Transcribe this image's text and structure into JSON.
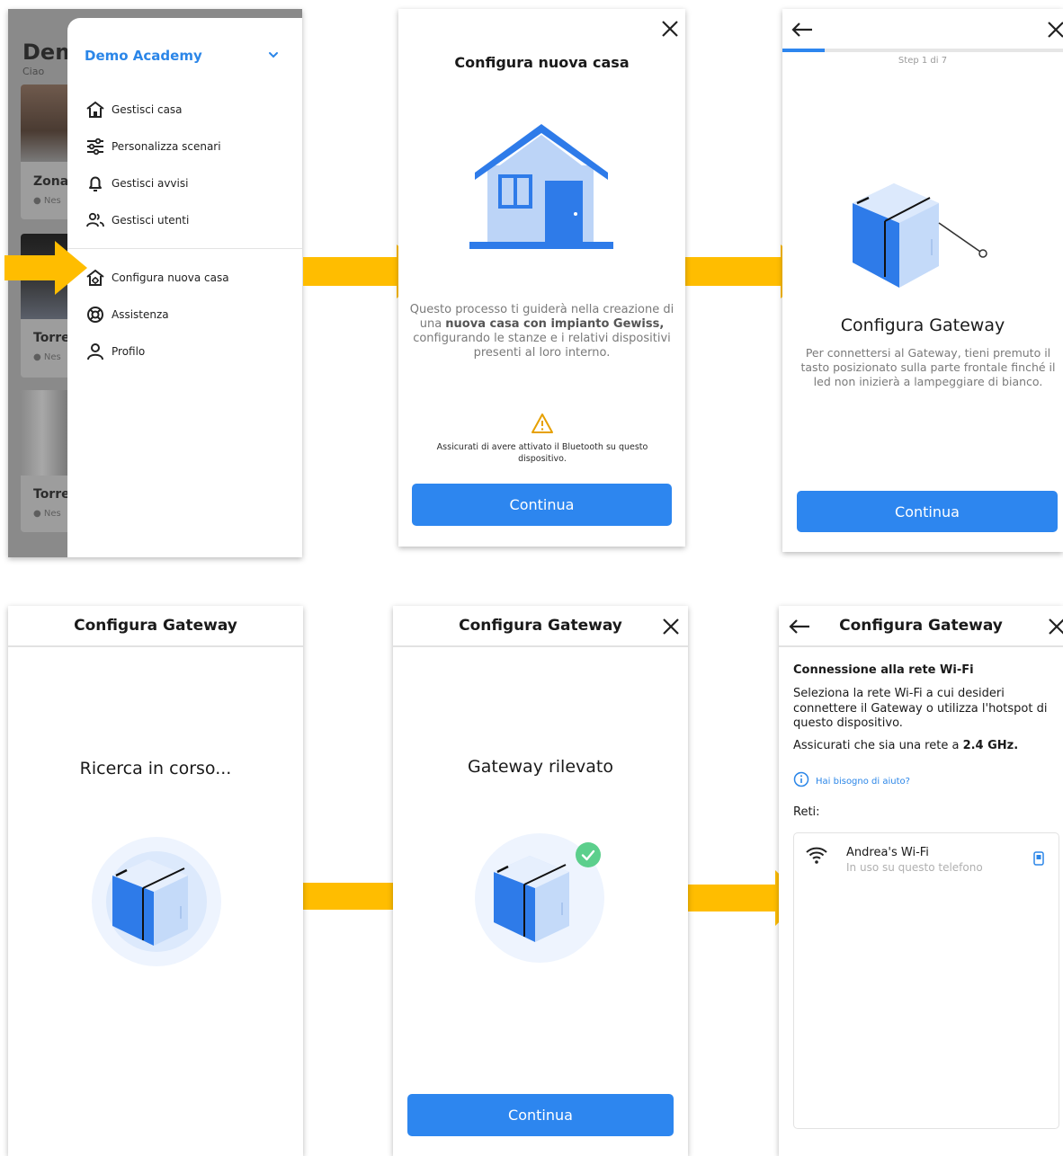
{
  "colors": {
    "accent": "#2d86ef",
    "arrow": "#ffbd00",
    "house": "#bcd4f7",
    "house_dark": "#2e7be9",
    "check": "#5ccf8c"
  },
  "screen1": {
    "bg_title": "Dem",
    "bg_sub": "Ciao",
    "bg_cards": [
      {
        "label": "Zona",
        "status": "Nes"
      },
      {
        "label": "Torre",
        "status": "Nes"
      },
      {
        "label": "Torre",
        "status": "Nes"
      }
    ],
    "account": "Demo Academy",
    "menu": [
      {
        "label": "Gestisci casa",
        "icon": "home-icon"
      },
      {
        "label": "Personalizza scenari",
        "icon": "sliders-icon"
      },
      {
        "label": "Gestisci avvisi",
        "icon": "bell-icon"
      },
      {
        "label": "Gestisci utenti",
        "icon": "users-icon"
      }
    ],
    "menu2": [
      {
        "label": "Configura nuova casa",
        "icon": "home-config-icon"
      },
      {
        "label": "Assistenza",
        "icon": "lifebuoy-icon"
      },
      {
        "label": "Profilo",
        "icon": "user-icon"
      }
    ]
  },
  "screen2": {
    "title": "Configura nuova casa",
    "body_1": "Questo processo ti guiderà nella creazione di una ",
    "body_bold": "nuova casa con impianto Gewiss,",
    "body_2": " configurando le stanze e i relativi dispositivi presenti al loro interno.",
    "warning": "Assicurati di avere attivato il Bluetooth su questo dispositivo.",
    "button": "Continua"
  },
  "screen3": {
    "step": "Step 1 di 7",
    "title": "Configura Gateway",
    "body": "Per connettersi al Gateway, tieni premuto il tasto posizionato sulla parte frontale finché il led non inizierà a lampeggiare di bianco.",
    "button": "Continua"
  },
  "screen4": {
    "title": "Configura Gateway",
    "status": "Ricerca in corso..."
  },
  "screen5": {
    "title": "Configura Gateway",
    "status": "Gateway rilevato",
    "button": "Continua"
  },
  "screen6": {
    "title": "Configura Gateway",
    "section": "Connessione alla rete Wi-Fi",
    "desc": "Seleziona la rete Wi-Fi a cui desideri connettere il Gateway o utilizza l'hotspot di questo dispositivo.",
    "desc2_prefix": "Assicurati che sia una rete a ",
    "desc2_bold": "2.4 GHz.",
    "help": "Hai bisogno di aiuto?",
    "networks_label": "Reti:",
    "networks": [
      {
        "name": "Andrea's Wi-Fi",
        "status": "In uso su questo telefono"
      }
    ]
  }
}
